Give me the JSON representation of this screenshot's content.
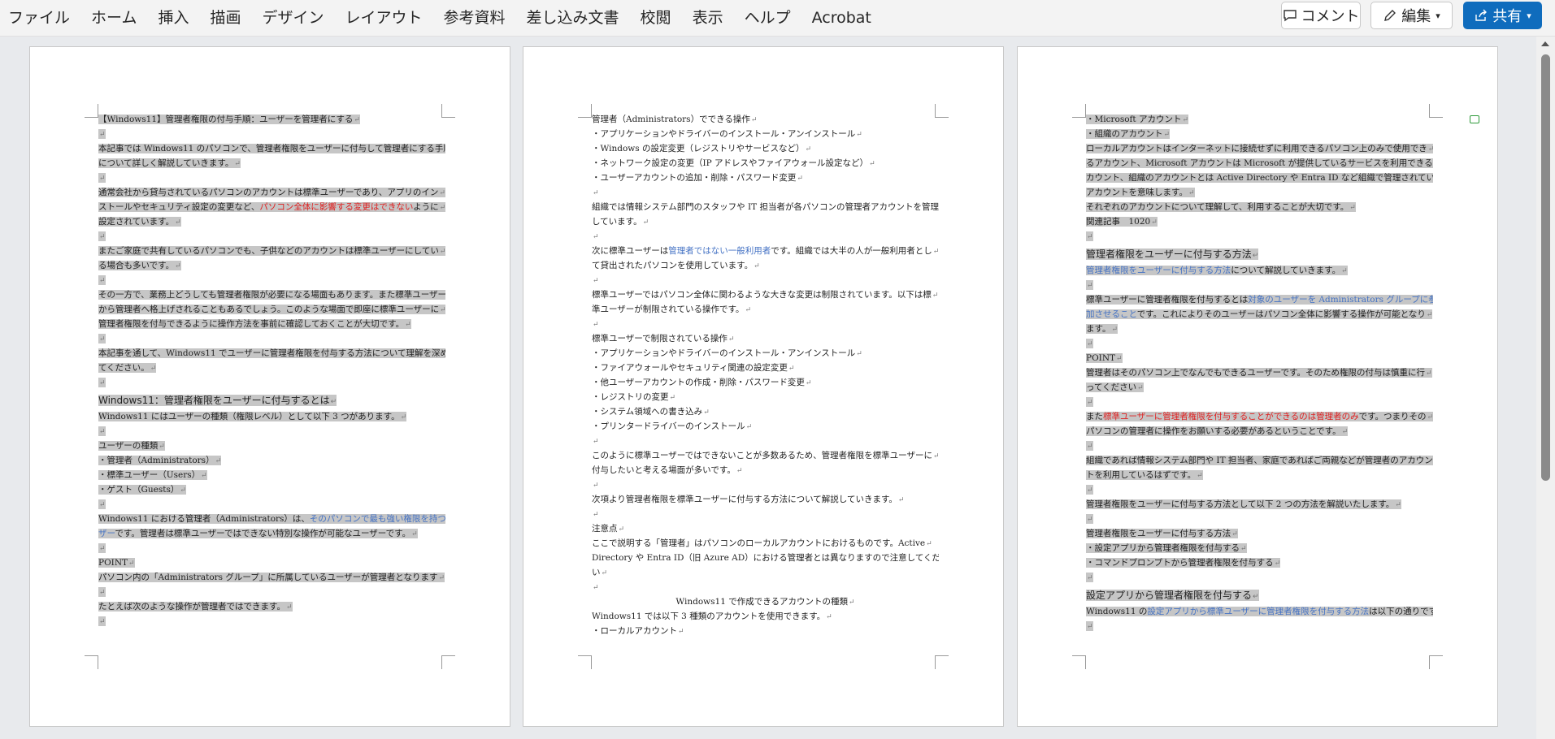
{
  "ribbon": {
    "tabs": [
      "ファイル",
      "ホーム",
      "挿入",
      "描画",
      "デザイン",
      "レイアウト",
      "参考資料",
      "差し込み文書",
      "校閲",
      "表示",
      "ヘルプ",
      "Acrobat"
    ],
    "comment_label": "コメント",
    "edit_label": "編集",
    "share_label": "共有"
  },
  "pages": [
    {
      "lines": [
        {
          "k": "t",
          "s": [
            [
              "【Windows11】管理者権限の付与手順：ユーザーを管理者にする",
              ""
            ]
          ]
        },
        {
          "k": "b"
        },
        {
          "k": "t",
          "s": [
            [
              "本記事では Windows11 のパソコンで、管理者権限をユーザーに付与して管理者にする手順",
              ""
            ]
          ]
        },
        {
          "k": "t",
          "s": [
            [
              "について詳しく解説していきます。",
              ""
            ]
          ]
        },
        {
          "k": "b"
        },
        {
          "k": "t",
          "s": [
            [
              "通常会社から貸与されているパソコンのアカウントは標準ユーザーであり、アプリのイン",
              ""
            ]
          ]
        },
        {
          "k": "t",
          "s": [
            [
              "ストールやセキュリティ設定の変更など、",
              ""
            ],
            [
              "パソコン全体に影響する変更はできない",
              "red"
            ],
            [
              "ように",
              ""
            ]
          ]
        },
        {
          "k": "t",
          "s": [
            [
              "設定されています。",
              ""
            ]
          ]
        },
        {
          "k": "b"
        },
        {
          "k": "t",
          "s": [
            [
              "またご家庭で共有しているパソコンでも、子供などのアカウントは標準ユーザーにしてい",
              ""
            ]
          ]
        },
        {
          "k": "t",
          "s": [
            [
              "る場合も多いです。",
              ""
            ]
          ]
        },
        {
          "k": "b"
        },
        {
          "k": "t",
          "s": [
            [
              "その一方で、業務上どうしても管理者権限が必要になる場面もあります。また標準ユーザー",
              ""
            ]
          ]
        },
        {
          "k": "t",
          "s": [
            [
              "から管理者へ格上げされることもあるでしょう。このような場面で即座に標準ユーザーに",
              ""
            ]
          ]
        },
        {
          "k": "t",
          "s": [
            [
              "管理者権限を付与できるように操作方法を事前に確認しておくことが大切です。",
              ""
            ]
          ]
        },
        {
          "k": "b"
        },
        {
          "k": "t",
          "s": [
            [
              "本記事を通して、Windows11 でユーザーに管理者権限を付与する方法について理解を深め",
              ""
            ]
          ]
        },
        {
          "k": "t",
          "s": [
            [
              "てください。",
              ""
            ]
          ]
        },
        {
          "k": "b"
        },
        {
          "k": "h",
          "s": [
            [
              "Windows11：管理者権限をユーザーに付与するとは",
              ""
            ]
          ]
        },
        {
          "k": "t",
          "s": [
            [
              "Windows11 にはユーザーの種類（権限レベル）として以下 3 つがあります。",
              ""
            ]
          ]
        },
        {
          "k": "b"
        },
        {
          "k": "t",
          "s": [
            [
              "ユーザーの種類",
              ""
            ]
          ]
        },
        {
          "k": "t",
          "s": [
            [
              "・管理者（Administrators）",
              ""
            ]
          ]
        },
        {
          "k": "t",
          "s": [
            [
              "・標準ユーザー（Users）",
              ""
            ]
          ]
        },
        {
          "k": "t",
          "s": [
            [
              "・ゲスト（Guests）",
              ""
            ]
          ]
        },
        {
          "k": "b"
        },
        {
          "k": "t",
          "s": [
            [
              "Windows11 における管理者（Administrators）は、",
              ""
            ],
            [
              "そのパソコンで最も強い権限を持つユー",
              "blue"
            ]
          ]
        },
        {
          "k": "t",
          "s": [
            [
              "ザー",
              "blue"
            ],
            [
              "です。管理者は標準ユーザーではできない特別な操作が可能なユーザーです。",
              ""
            ]
          ]
        },
        {
          "k": "b"
        },
        {
          "k": "t",
          "s": [
            [
              "POINT",
              ""
            ]
          ]
        },
        {
          "k": "t",
          "s": [
            [
              "パソコン内の「Administrators グループ」に所属しているユーザーが管理者となります",
              ""
            ]
          ]
        },
        {
          "k": "b"
        },
        {
          "k": "t",
          "s": [
            [
              "たとえば次のような操作が管理者ではできます。",
              ""
            ]
          ]
        },
        {
          "k": "b"
        }
      ]
    },
    {
      "lines": [
        {
          "k": "t",
          "s": [
            [
              "管理者（Administrators）でできる操作",
              ""
            ]
          ]
        },
        {
          "k": "t",
          "s": [
            [
              "・アプリケーションやドライバーのインストール・アンインストール",
              ""
            ]
          ]
        },
        {
          "k": "t",
          "s": [
            [
              "・Windows の設定変更（レジストリやサービスなど）",
              ""
            ]
          ]
        },
        {
          "k": "t",
          "s": [
            [
              "・ネットワーク設定の変更（IP アドレスやファイアウォール設定など）",
              ""
            ]
          ]
        },
        {
          "k": "t",
          "s": [
            [
              "・ユーザーアカウントの追加・削除・パスワード変更",
              ""
            ]
          ]
        },
        {
          "k": "b"
        },
        {
          "k": "t",
          "s": [
            [
              "組織では情報システム部門のスタッフや IT 担当者が各パソコンの管理者アカウントを管理",
              ""
            ]
          ]
        },
        {
          "k": "t",
          "s": [
            [
              "しています。",
              ""
            ]
          ]
        },
        {
          "k": "b"
        },
        {
          "k": "t",
          "s": [
            [
              "次に標準ユーザーは",
              ""
            ],
            [
              "管理者ではない一般利用者",
              "blue"
            ],
            [
              "です。組織では大半の人が一般利用者とし",
              ""
            ]
          ]
        },
        {
          "k": "t",
          "s": [
            [
              "て貸出されたパソコンを使用しています。",
              ""
            ]
          ]
        },
        {
          "k": "b"
        },
        {
          "k": "t",
          "s": [
            [
              "標準ユーザーではパソコン全体に関わるような大きな変更は制限されています。以下は標",
              ""
            ]
          ]
        },
        {
          "k": "t",
          "s": [
            [
              "準ユーザーが制限されている操作です。",
              ""
            ]
          ]
        },
        {
          "k": "b"
        },
        {
          "k": "t",
          "s": [
            [
              "標準ユーザーで制限されている操作",
              ""
            ]
          ]
        },
        {
          "k": "t",
          "s": [
            [
              "・アプリケーションやドライバーのインストール・アンインストール",
              ""
            ]
          ]
        },
        {
          "k": "t",
          "s": [
            [
              "・ファイアウォールやセキュリティ関連の設定変更",
              ""
            ]
          ]
        },
        {
          "k": "t",
          "s": [
            [
              "・他ユーザーアカウントの作成・削除・パスワード変更",
              ""
            ]
          ]
        },
        {
          "k": "t",
          "s": [
            [
              "・レジストリの変更",
              ""
            ]
          ]
        },
        {
          "k": "t",
          "s": [
            [
              "・システム領域への書き込み",
              ""
            ]
          ]
        },
        {
          "k": "t",
          "s": [
            [
              "・プリンタードライバーのインストール",
              ""
            ]
          ]
        },
        {
          "k": "b"
        },
        {
          "k": "t",
          "s": [
            [
              "このように標準ユーザーではできないことが多数あるため、管理者権限を標準ユーザーに",
              ""
            ]
          ]
        },
        {
          "k": "t",
          "s": [
            [
              "付与したいと考える場面が多いです。",
              ""
            ]
          ]
        },
        {
          "k": "b"
        },
        {
          "k": "t",
          "s": [
            [
              "次項より管理者権限を標準ユーザーに付与する方法について解説していきます。",
              ""
            ]
          ]
        },
        {
          "k": "b"
        },
        {
          "k": "t",
          "s": [
            [
              "注意点",
              ""
            ]
          ]
        },
        {
          "k": "t",
          "s": [
            [
              "ここで説明する「管理者」はパソコンのローカルアカウントにおけるものです。Active",
              ""
            ]
          ]
        },
        {
          "k": "t",
          "s": [
            [
              "Directory や Entra ID（旧 Azure AD）における管理者とは異なりますので注意してくださ",
              ""
            ]
          ]
        },
        {
          "k": "t",
          "s": [
            [
              "い",
              ""
            ]
          ]
        },
        {
          "k": "b"
        },
        {
          "k": "c",
          "s": [
            [
              "Windows11 で作成できるアカウントの種類",
              ""
            ]
          ]
        },
        {
          "k": "t",
          "s": [
            [
              "Windows11 では以下 3 種類のアカウントを使用できます。",
              ""
            ]
          ]
        },
        {
          "k": "t",
          "s": [
            [
              "・ローカルアカウント",
              ""
            ]
          ]
        }
      ]
    },
    {
      "lines": [
        {
          "k": "t",
          "s": [
            [
              "・Microsoft アカウント",
              ""
            ]
          ]
        },
        {
          "k": "t",
          "s": [
            [
              "・組織のアカウント",
              ""
            ]
          ]
        },
        {
          "k": "t",
          "s": [
            [
              "ローカルアカウントはインターネットに接続せずに利用できるパソコン上のみで使用でき",
              ""
            ]
          ]
        },
        {
          "k": "t",
          "s": [
            [
              "るアカウント、Microsoft アカウントは Microsoft が提供しているサービスを利用できるア",
              ""
            ]
          ]
        },
        {
          "k": "t",
          "s": [
            [
              "カウント、組織のアカウントとは Active Directory や Entra ID など組織で管理されている",
              ""
            ]
          ]
        },
        {
          "k": "t",
          "s": [
            [
              "アカウントを意味します。",
              ""
            ]
          ]
        },
        {
          "k": "t",
          "s": [
            [
              "それぞれのアカウントについて理解して、利用することが大切です。",
              ""
            ]
          ]
        },
        {
          "k": "t",
          "s": [
            [
              "関連記事　1020",
              ""
            ]
          ]
        },
        {
          "k": "b"
        },
        {
          "k": "h",
          "s": [
            [
              "管理者権限をユーザーに付与する方法",
              ""
            ]
          ]
        },
        {
          "k": "t",
          "s": [
            [
              "管理者権限をユーザーに付与する方法",
              "blue"
            ],
            [
              "について解説していきます。",
              ""
            ]
          ]
        },
        {
          "k": "b"
        },
        {
          "k": "t",
          "s": [
            [
              "標準ユーザーに管理者権限を付与するとは",
              ""
            ],
            [
              "対象のユーザーを Administrators グループに参",
              "blue"
            ]
          ]
        },
        {
          "k": "t",
          "s": [
            [
              "加させること",
              "blue"
            ],
            [
              "です。これによりそのユーザーはパソコン全体に影響する操作が可能となり",
              ""
            ]
          ]
        },
        {
          "k": "t",
          "s": [
            [
              "ます。",
              ""
            ]
          ]
        },
        {
          "k": "b"
        },
        {
          "k": "t",
          "s": [
            [
              "POINT",
              ""
            ]
          ]
        },
        {
          "k": "t",
          "s": [
            [
              "管理者はそのパソコン上でなんでもできるユーザーです。そのため権限の付与は慎重に行",
              ""
            ]
          ]
        },
        {
          "k": "t",
          "s": [
            [
              "ってください",
              ""
            ]
          ]
        },
        {
          "k": "b"
        },
        {
          "k": "t",
          "s": [
            [
              "また",
              ""
            ],
            [
              "標準ユーザーに管理者権限を付与することができるのは管理者のみ",
              "red"
            ],
            [
              "です。つまりその",
              ""
            ]
          ]
        },
        {
          "k": "t",
          "s": [
            [
              "パソコンの管理者に操作をお願いする必要があるということです。",
              ""
            ]
          ]
        },
        {
          "k": "b"
        },
        {
          "k": "t",
          "s": [
            [
              "組織であれば情報システム部門や IT 担当者、家庭であればご両親などが管理者のアカウン",
              ""
            ]
          ]
        },
        {
          "k": "t",
          "s": [
            [
              "トを利用しているはずです。",
              ""
            ]
          ]
        },
        {
          "k": "b"
        },
        {
          "k": "t",
          "s": [
            [
              "管理者権限をユーザーに付与する方法として以下 2 つの方法を解説いたします。",
              ""
            ]
          ]
        },
        {
          "k": "b"
        },
        {
          "k": "t",
          "s": [
            [
              "管理者権限をユーザーに付与する方法",
              ""
            ]
          ]
        },
        {
          "k": "t",
          "s": [
            [
              "・設定アプリから管理者権限を付与する",
              ""
            ]
          ]
        },
        {
          "k": "t",
          "s": [
            [
              "・コマンドプロンプトから管理者権限を付与する",
              ""
            ]
          ]
        },
        {
          "k": "b"
        },
        {
          "k": "h",
          "s": [
            [
              "設定アプリから管理者権限を付与する",
              ""
            ]
          ]
        },
        {
          "k": "t",
          "s": [
            [
              "Windows11 の",
              ""
            ],
            [
              "設定アプリから標準ユーザーに管理者権限を付与する方法",
              "blue"
            ],
            [
              "は以下の通りです。",
              ""
            ]
          ]
        },
        {
          "k": "b"
        }
      ]
    }
  ]
}
